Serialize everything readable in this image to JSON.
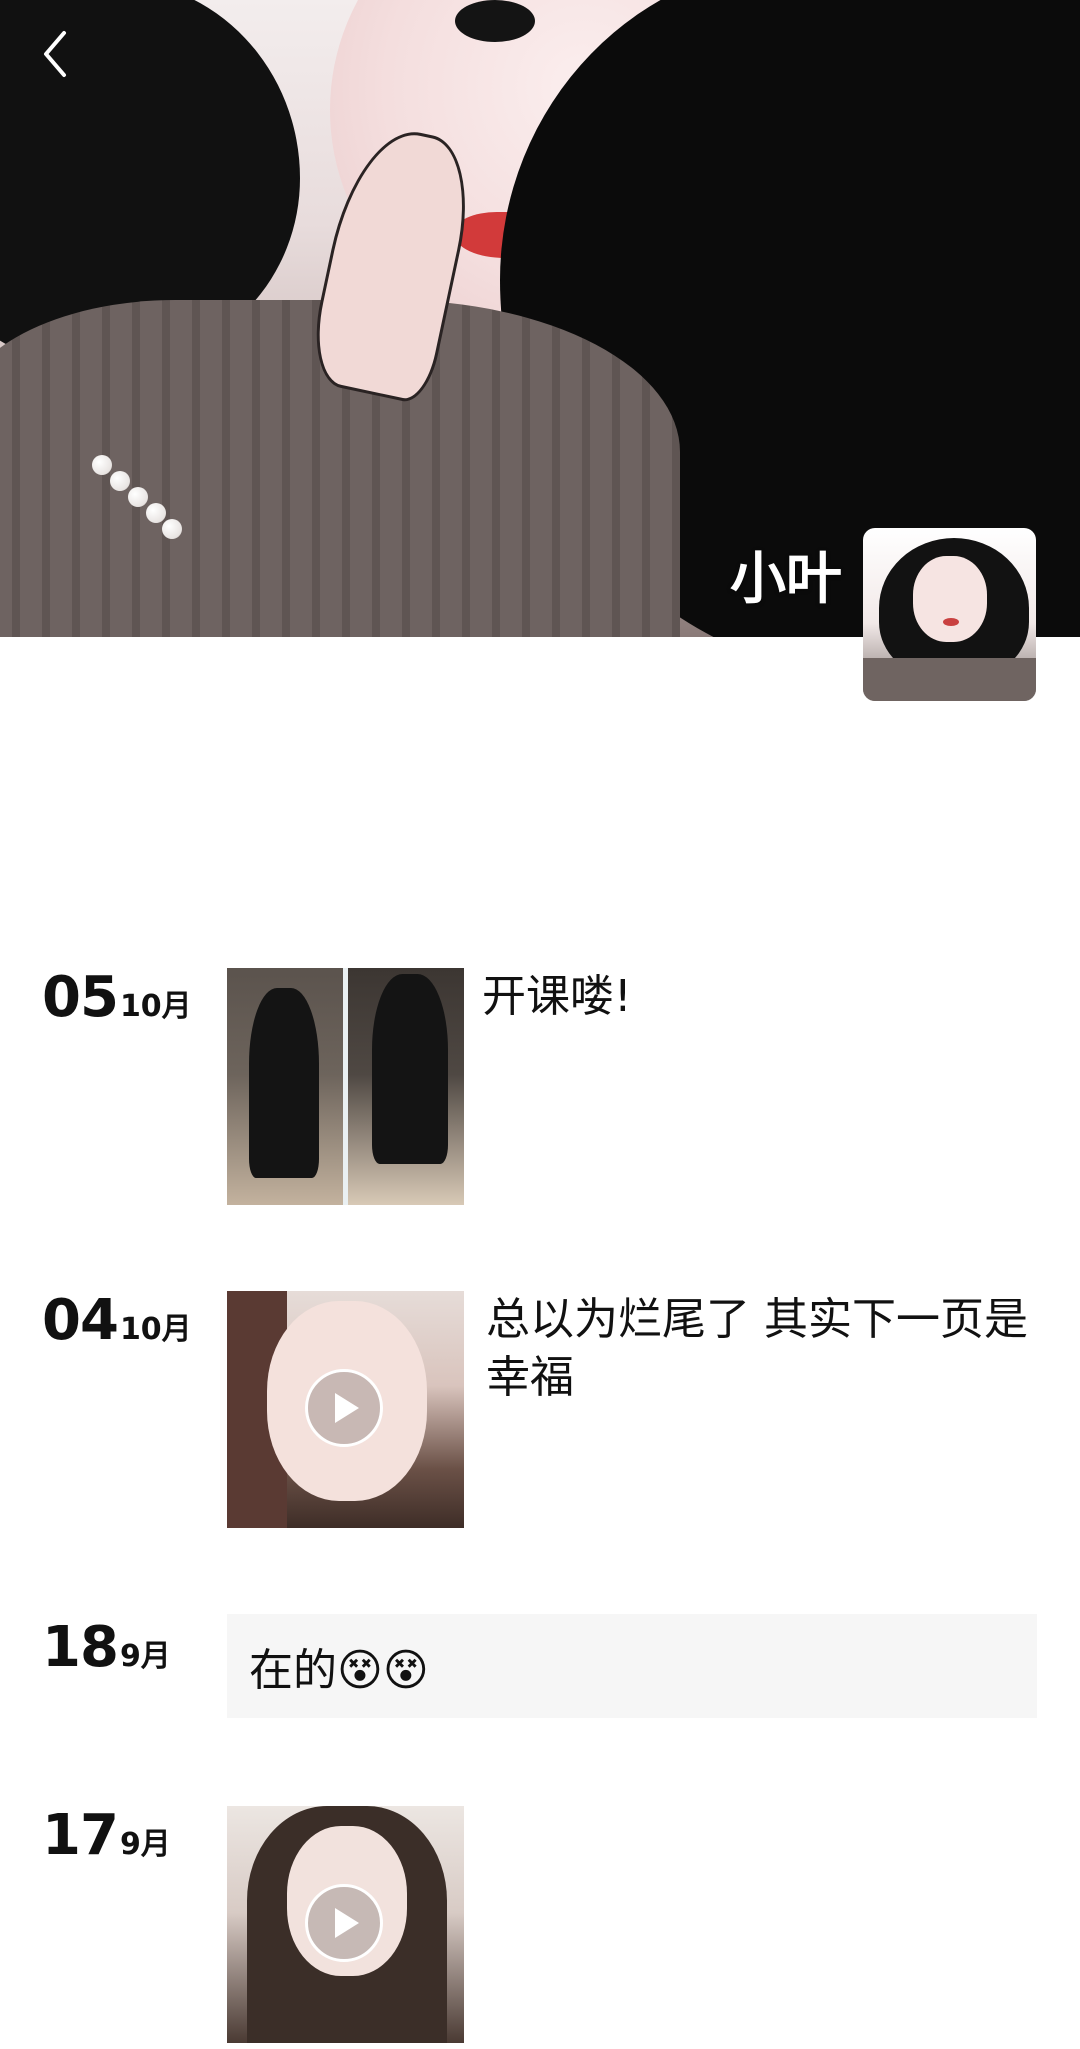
{
  "profile": {
    "name": "小叶"
  },
  "posts": [
    {
      "day": "05",
      "month": "10月",
      "text": "开课喽!",
      "media": "photo"
    },
    {
      "day": "04",
      "month": "10月",
      "text": "总以为烂尾了 其实下一页是幸福",
      "media": "video"
    },
    {
      "day": "18",
      "month": "9月",
      "text": "在的😵😵",
      "media": "none"
    },
    {
      "day": "17",
      "month": "9月",
      "text": "",
      "media": "video"
    }
  ]
}
